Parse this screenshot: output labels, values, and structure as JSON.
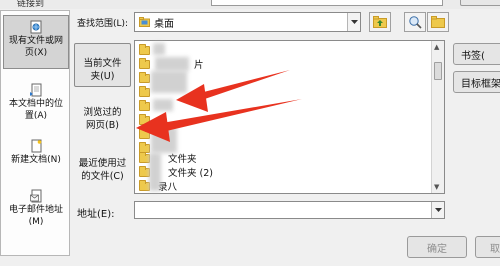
{
  "top": {
    "left_text": "链接到"
  },
  "places": [
    {
      "label": "现有文件或网\n页(X)",
      "icon": "globe-page-icon",
      "selected": true
    },
    {
      "label": "本文档中的位\n置(A)",
      "icon": "document-place-icon",
      "selected": false
    },
    {
      "label": "新建文档(N)",
      "icon": "new-document-icon",
      "selected": false
    },
    {
      "label": "电子邮件地址\n(M)",
      "icon": "email-address-icon",
      "selected": false
    }
  ],
  "look_in": {
    "label": "查找范围(L):",
    "value": "桌面",
    "icon": "desktop-folder-icon"
  },
  "toolbar": {
    "up_icon": "up-folder-icon",
    "browse_web_icon": "browse-web-icon",
    "browse_file_icon": "browse-file-icon"
  },
  "nav": [
    {
      "label": "当前文件\n夹(U)",
      "selected": true
    },
    {
      "label": "浏览过的\n网页(B)",
      "selected": false
    },
    {
      "label": "最近使用过\n的文件(C)",
      "selected": false
    }
  ],
  "files": [
    {
      "name": "",
      "blurred": true
    },
    {
      "name": "片",
      "blurred": true
    },
    {
      "name": "",
      "blurred": true
    },
    {
      "name": "",
      "blurred": true
    },
    {
      "name": "",
      "blurred": true
    },
    {
      "name": "",
      "blurred": true
    },
    {
      "name": "",
      "blurred": true
    },
    {
      "name": "",
      "blurred": true
    },
    {
      "name": "文件夹",
      "blurred": true
    },
    {
      "name": "文件夹 (2)",
      "blurred": true
    },
    {
      "name": "录八",
      "blurred": true
    }
  ],
  "address": {
    "label": "地址(E):",
    "value": ""
  },
  "buttons": {
    "bookmark": "书签(",
    "target_frame": "目标框架",
    "ok": "确定",
    "cancel": "取"
  },
  "colors": {
    "arrow": "#e8321f",
    "selection": "#d4d4d4",
    "folder": "#eec94c"
  }
}
